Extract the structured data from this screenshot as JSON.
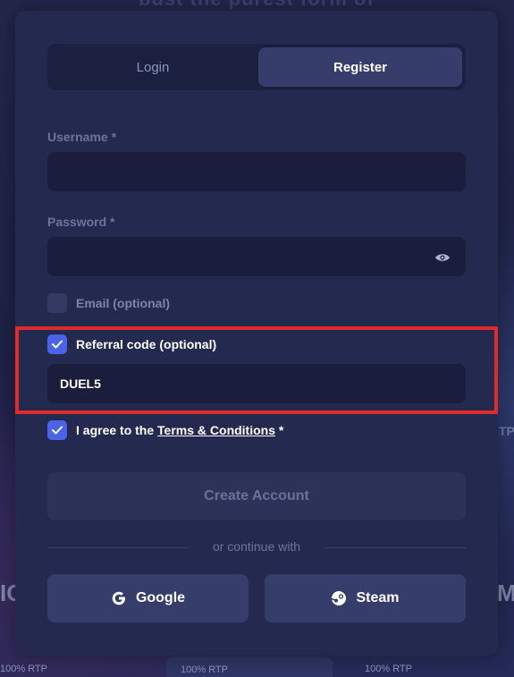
{
  "background": {
    "top_text": "bust the purest form of",
    "left_side_text": "IC",
    "right_side_text": "MI",
    "right_side_small": "TP",
    "bottom_left_text": "100% RTP",
    "bottom_pill_text": "100% RTP",
    "bottom_right_text": "100% RTP"
  },
  "tabs": {
    "login": "Login",
    "register": "Register",
    "active": "register"
  },
  "username": {
    "label": "Username *",
    "value": "",
    "placeholder": ""
  },
  "password": {
    "label": "Password *",
    "value": "",
    "placeholder": "",
    "toggle_icon": "eye-icon"
  },
  "email_option": {
    "label": "Email (optional)",
    "checked": false
  },
  "referral_option": {
    "label": "Referral code (optional)",
    "checked": true,
    "value": "DUEL5"
  },
  "terms": {
    "prefix": "I agree to the ",
    "link": "Terms & Conditions",
    "suffix": " *",
    "checked": true
  },
  "create_button": "Create Account",
  "divider_text": "or continue with",
  "social": {
    "google": "Google",
    "steam": "Steam"
  },
  "colors": {
    "accent": "#4a63e8",
    "highlight": "#e02b2b",
    "panel": "#242a4f",
    "input_bg": "#1a1e3c"
  }
}
